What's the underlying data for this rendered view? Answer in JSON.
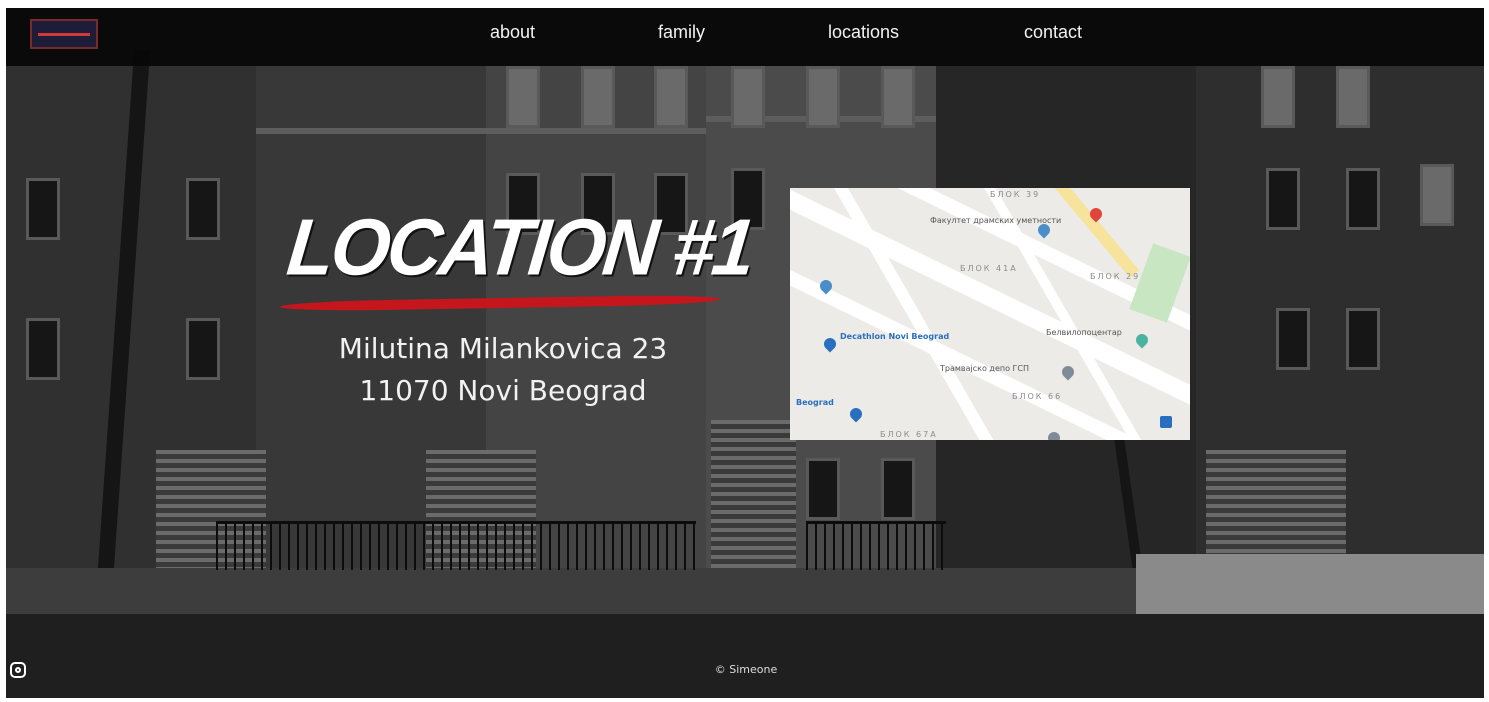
{
  "nav": {
    "links": [
      "about",
      "family",
      "locations",
      "contact"
    ]
  },
  "hero": {
    "title": "LOCATION #1",
    "address_line1": "Milutina Milankovica 23",
    "address_line2": "11070 Novi Beograd"
  },
  "map": {
    "labels": {
      "blok39": "БЛОК 39",
      "faculty": "Факултет драмских уметности",
      "blok41a": "БЛОК 41А",
      "blok29": "БЛОК 29",
      "decathlon": "Decathlon Novi Beograd",
      "bel": "Белвилопоцентар",
      "tram": "Трамвајско депо ГСП",
      "blok66": "БЛОК 66",
      "beograd": "Beograd",
      "blok67a": "БЛОК 67А"
    }
  },
  "footer": {
    "copyright": "© Simeone"
  },
  "colors": {
    "accent": "#c4161c",
    "navbar": "#080808"
  }
}
